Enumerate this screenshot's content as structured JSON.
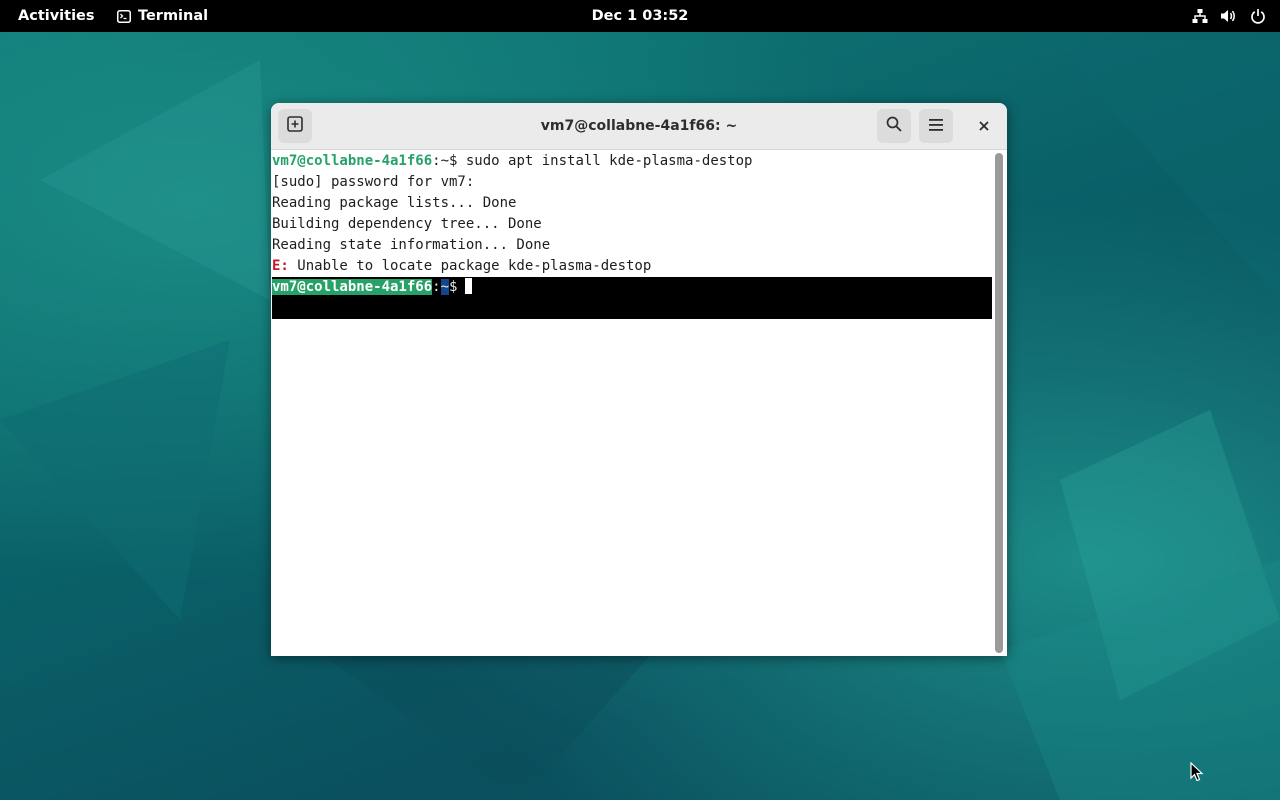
{
  "topbar": {
    "activities": "Activities",
    "app_name": "Terminal",
    "clock": "Dec 1  03:52",
    "tray_icons": [
      "network-icon",
      "volume-icon",
      "power-icon"
    ]
  },
  "window": {
    "title": "vm7@collabne-4a1f66: ~",
    "buttons": [
      "new-tab-icon",
      "search-icon",
      "hamburger-menu-icon",
      "close-icon"
    ]
  },
  "terminal": {
    "line1": {
      "user_host": "vm7@collabne-4a1f66",
      "path_prompt": ":~$",
      "command": " sudo apt install kde-plasma-destop"
    },
    "line2": "[sudo] password for vm7:",
    "line3": "Reading package lists... Done",
    "line4": "Building dependency tree... Done",
    "line5": "Reading state information... Done",
    "line6": {
      "error_prefix": "E:",
      "message": " Unable to locate package kde-plasma-destop"
    },
    "prompt": {
      "user_host": "vm7@collabne-4a1f66",
      "colon": ":",
      "path": "~",
      "dollar": "$"
    }
  },
  "colors": {
    "prompt_green": "#26a269",
    "error_red": "#c01c28",
    "path_blue": "#12488b",
    "topbar": "#000000",
    "wallpaper": "#0a5a62"
  }
}
